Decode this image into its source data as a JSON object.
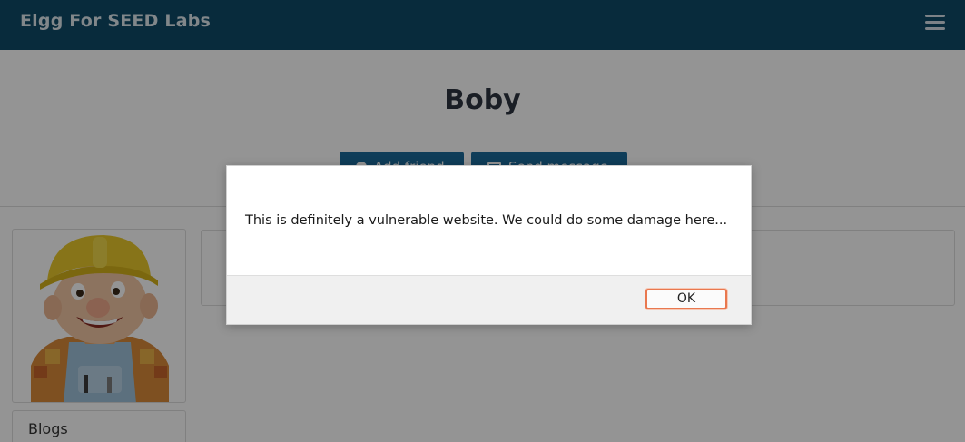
{
  "header": {
    "site_title": "Elgg For SEED Labs",
    "menu_icon": "hamburger-menu-icon",
    "bg_color": "#0e4a68"
  },
  "profile": {
    "name": "Boby",
    "buttons": {
      "add_friend": "Add friend",
      "send_message": "Send message"
    },
    "sidebar": {
      "blogs_label": "Blogs"
    },
    "avatar": "bob-the-builder-avatar"
  },
  "dialog": {
    "message": "This is definitely a vulnerable website. We could do some damage here...",
    "ok_label": "OK",
    "accent_color": "#e9784f"
  }
}
